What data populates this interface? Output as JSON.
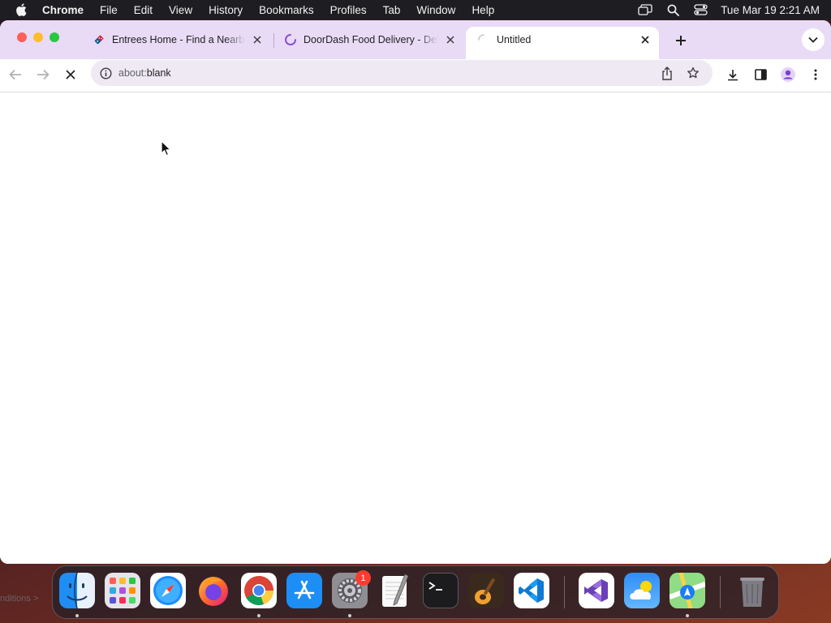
{
  "menubar": {
    "app_name": "Chrome",
    "items": [
      "File",
      "Edit",
      "View",
      "History",
      "Bookmarks",
      "Profiles",
      "Tab",
      "Window",
      "Help"
    ],
    "clock": "Tue Mar 19  2:21 AM",
    "status_icons": [
      "screen-mirroring-icon",
      "spotlight-search-icon",
      "control-center-icon"
    ]
  },
  "browser": {
    "tabs": [
      {
        "title": "Entrees Home - Find a Nearby",
        "favicon": "dominos-favicon-icon",
        "state": "loaded"
      },
      {
        "title": "DoorDash Food Delivery - Del",
        "favicon": "loading-spinner-icon",
        "state": "loading"
      },
      {
        "title": "Untitled",
        "favicon": "loading-spinner-icon",
        "state": "loading",
        "active": true
      }
    ],
    "omnibox": {
      "url_host": "about:",
      "url_path": "blank"
    },
    "colors": {
      "tabstrip": "#e9dbf6",
      "omnibox": "#efe9f3",
      "profile": "#7b3fd4"
    }
  },
  "desktop": {
    "partial_text": "nditions >"
  },
  "dock": {
    "apps": [
      {
        "name": "Finder",
        "running": true
      },
      {
        "name": "Launchpad",
        "running": false
      },
      {
        "name": "Safari",
        "running": false
      },
      {
        "name": "Firefox",
        "running": false
      },
      {
        "name": "Google Chrome",
        "running": true
      },
      {
        "name": "App Store",
        "running": false
      },
      {
        "name": "System Settings",
        "running": true,
        "badge": "1"
      },
      {
        "name": "TextEdit",
        "running": false
      },
      {
        "name": "Terminal",
        "running": false
      },
      {
        "name": "GarageBand",
        "running": false
      },
      {
        "name": "Visual Studio Code",
        "running": false
      },
      {
        "name": "Visual Studio",
        "running": false
      },
      {
        "name": "Weather",
        "running": false
      },
      {
        "name": "Maps",
        "running": true
      },
      {
        "name": "Trash",
        "running": false
      }
    ]
  }
}
